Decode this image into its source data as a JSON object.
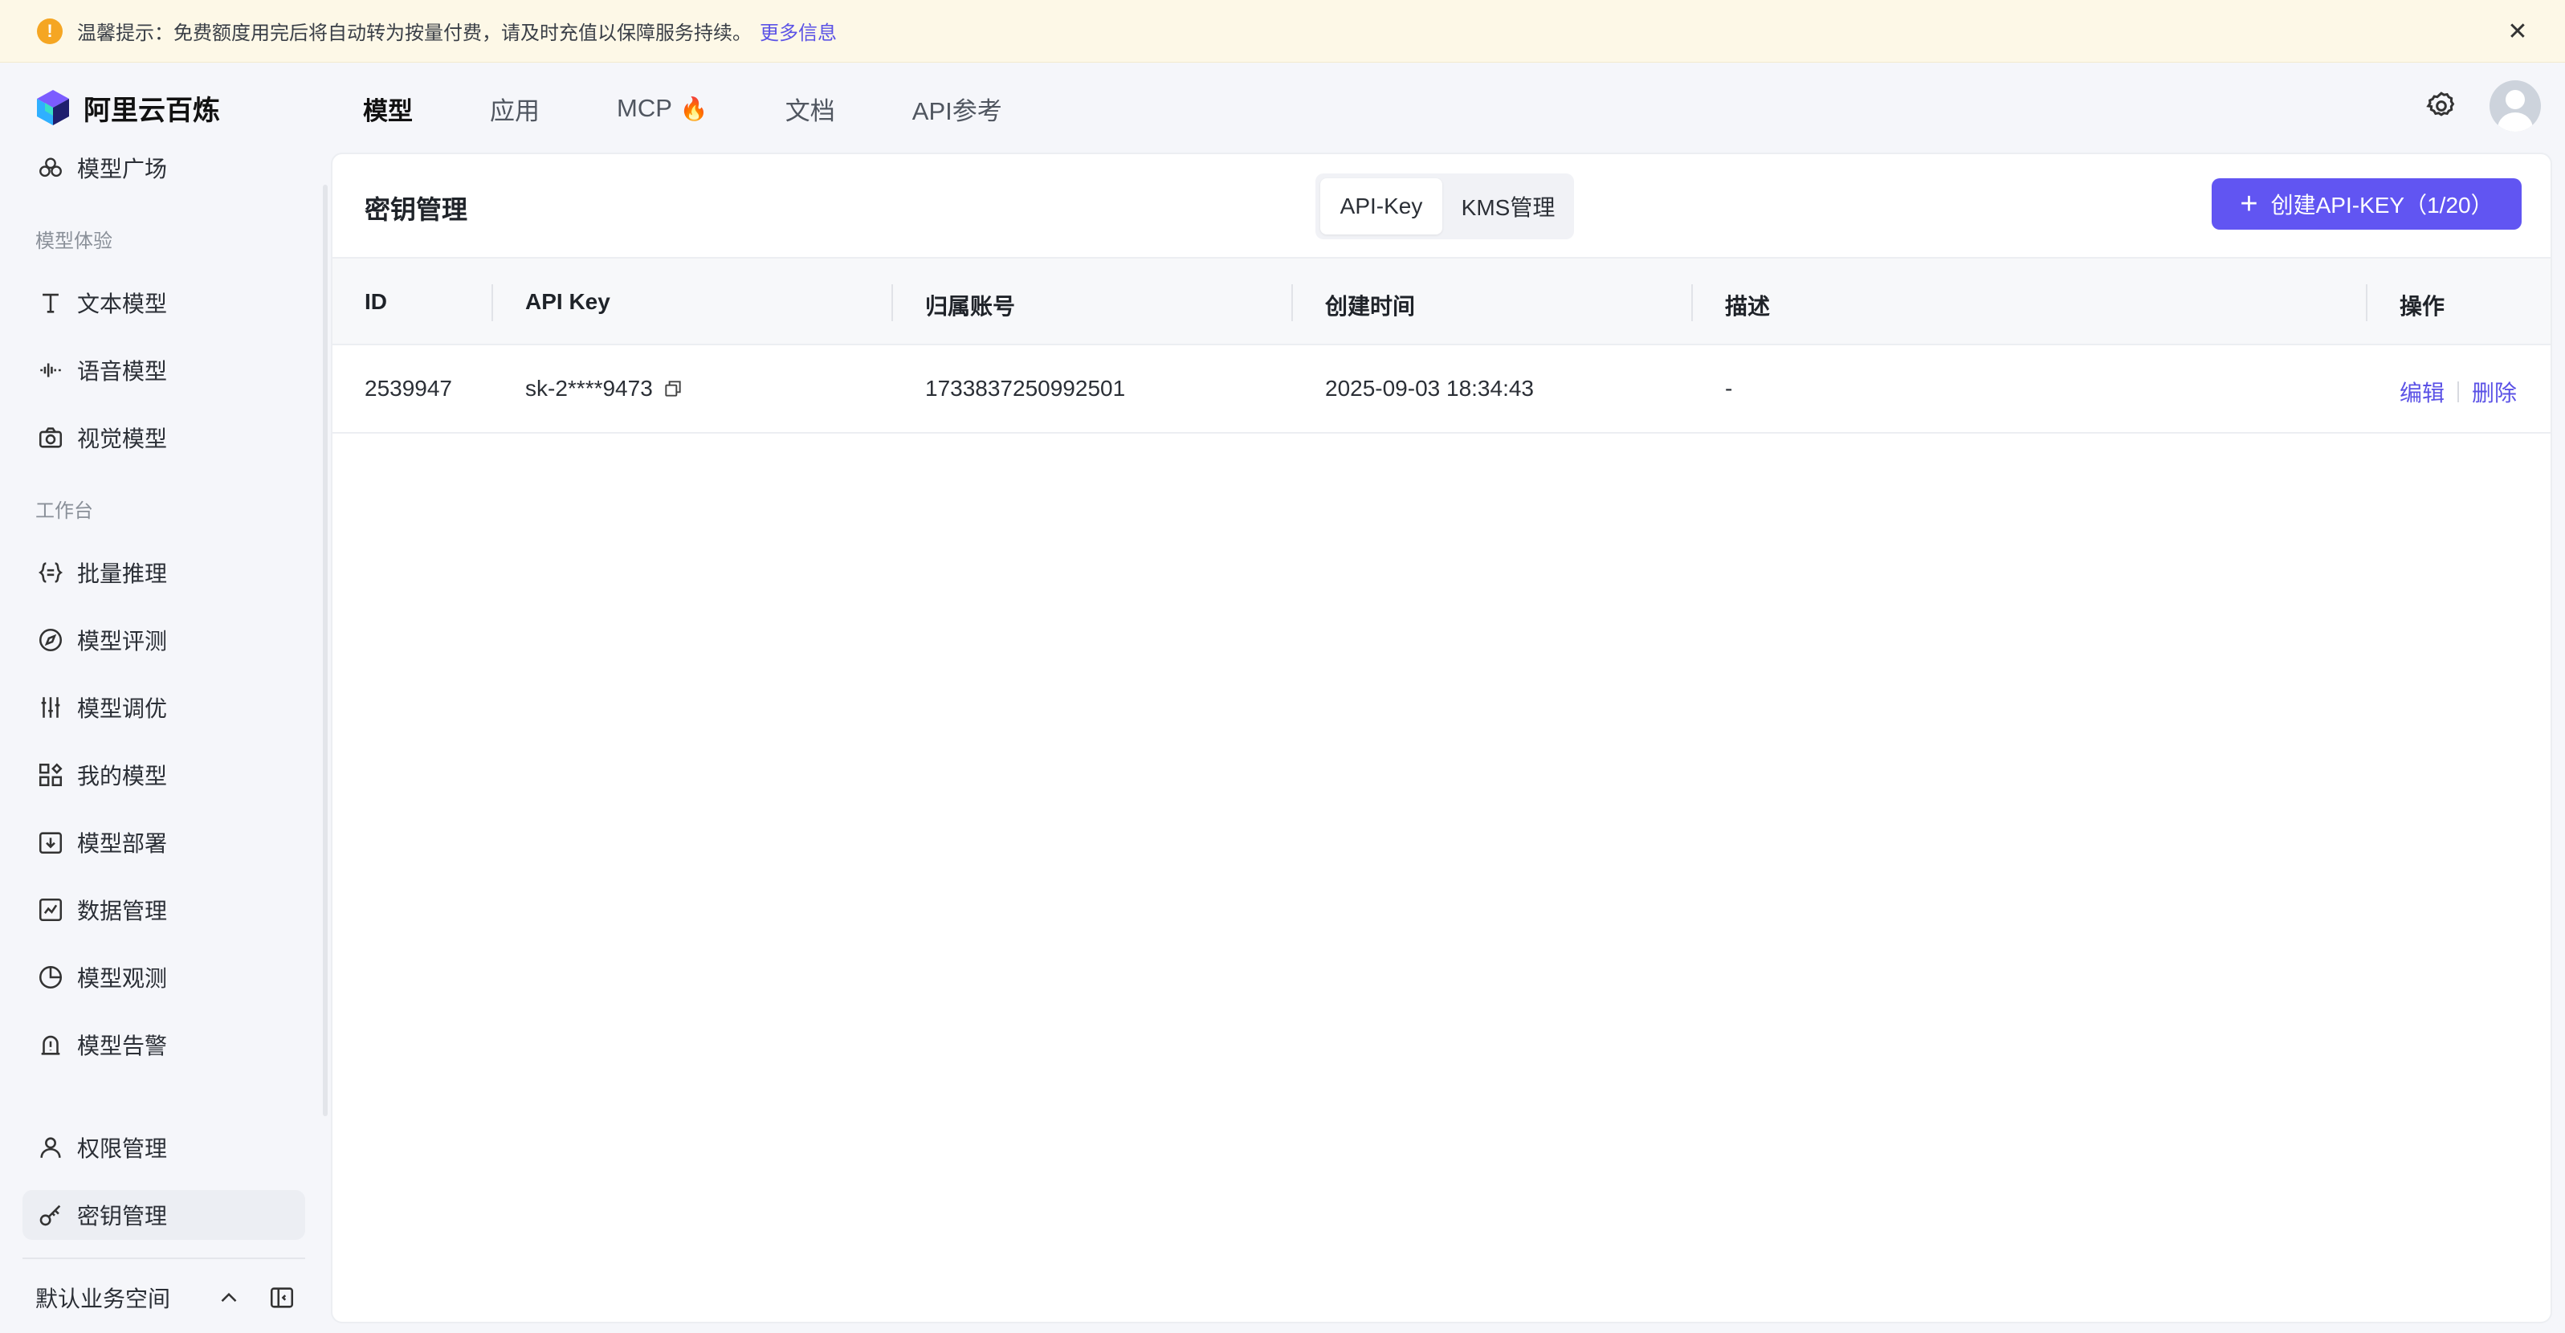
{
  "notice": {
    "text": "温馨提示：免费额度用完后将自动转为按量付费，请及时充值以保障服务持续。",
    "link": "更多信息",
    "icon": "warning-icon",
    "color": "#f5a623"
  },
  "app": {
    "name": "阿里云百炼"
  },
  "topnav": {
    "tabs": [
      {
        "label": "模型"
      },
      {
        "label": "应用"
      },
      {
        "label": "MCP",
        "badge": "🔥"
      },
      {
        "label": "文档"
      },
      {
        "label": "API参考"
      }
    ],
    "active": "模型"
  },
  "sidebar": {
    "top_item": {
      "label": "模型广场",
      "icon": "model-square-icon"
    },
    "groups": [
      {
        "title": "模型体验",
        "items": [
          {
            "label": "文本模型",
            "icon": "text-icon"
          },
          {
            "label": "语音模型",
            "icon": "waveform-icon"
          },
          {
            "label": "视觉模型",
            "icon": "camera-icon"
          }
        ]
      },
      {
        "title": "工作台",
        "items": [
          {
            "label": "批量推理",
            "icon": "braces-icon"
          },
          {
            "label": "模型评测",
            "icon": "compass-icon"
          },
          {
            "label": "模型调优",
            "icon": "sliders-icon"
          },
          {
            "label": "我的模型",
            "icon": "grid-icon"
          },
          {
            "label": "模型部署",
            "icon": "deploy-icon"
          },
          {
            "label": "数据管理",
            "icon": "chart-icon"
          },
          {
            "label": "模型观测",
            "icon": "pie-icon"
          },
          {
            "label": "模型告警",
            "icon": "alarm-icon"
          }
        ]
      }
    ],
    "bottom_items": [
      {
        "label": "权限管理",
        "icon": "user-icon"
      },
      {
        "label": "密钥管理",
        "icon": "key-icon",
        "active": true
      }
    ],
    "footer": {
      "workspace": "默认业务空间"
    }
  },
  "main": {
    "title": "密钥管理",
    "segments": [
      "API-Key",
      "KMS管理"
    ],
    "active_segment": "API-Key",
    "create_button": "创建API-KEY（1/20）",
    "accent": "#6155f2",
    "table": {
      "headers": [
        "ID",
        "API Key",
        "归属账号",
        "创建时间",
        "描述",
        "操作"
      ],
      "rows": [
        {
          "id": "2539947",
          "api_key": "sk-2****9473",
          "account": "1733837250992501",
          "created": "2025-09-03 18:34:43",
          "desc": "-",
          "actions": [
            "编辑",
            "删除"
          ]
        }
      ]
    }
  }
}
